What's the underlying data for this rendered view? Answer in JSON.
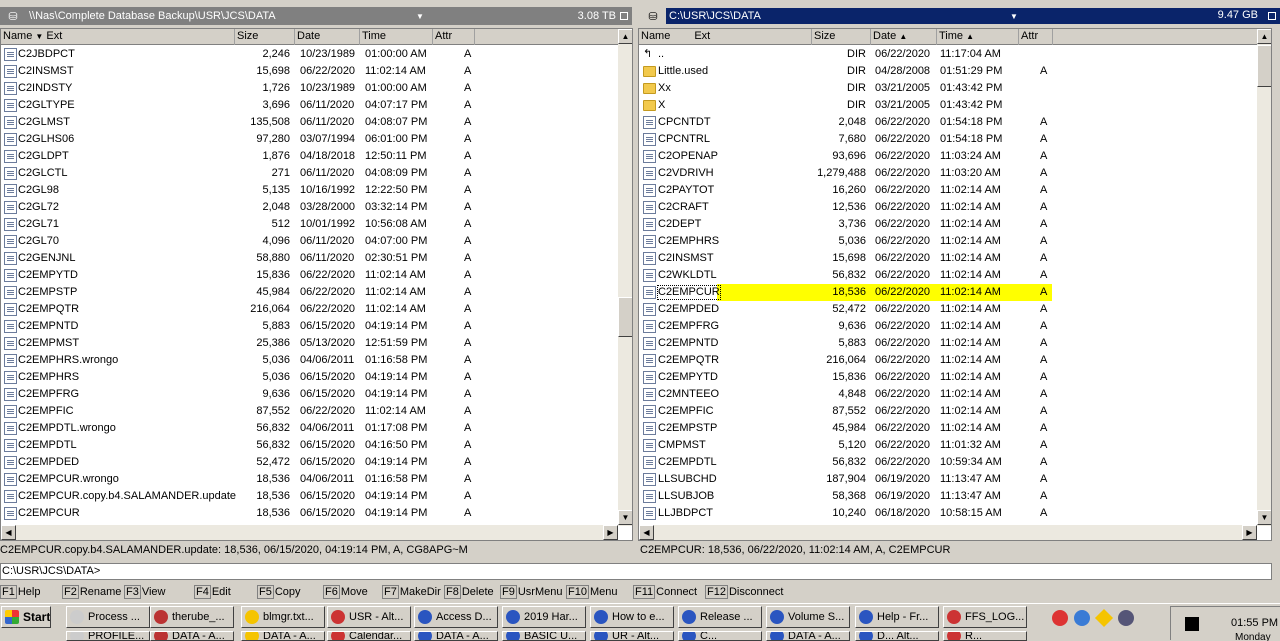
{
  "left_panel": {
    "path": "\\\\Nas\\Complete Database Backup\\USR\\JCS\\DATA",
    "free_space": "3.08 TB",
    "columns": {
      "name": "Name",
      "ext": "Ext",
      "size": "Size",
      "date": "Date",
      "time": "Time",
      "attr": "Attr"
    },
    "rows": [
      {
        "name": "C2JBDPCT",
        "size": "2,246",
        "date": "10/23/1989",
        "time": "01:00:00 AM",
        "attr": "A"
      },
      {
        "name": "C2INSMST",
        "size": "15,698",
        "date": "06/22/2020",
        "time": "11:02:14 AM",
        "attr": "A"
      },
      {
        "name": "C2INDSTY",
        "size": "1,726",
        "date": "10/23/1989",
        "time": "01:00:00 AM",
        "attr": "A"
      },
      {
        "name": "C2GLTYPE",
        "size": "3,696",
        "date": "06/11/2020",
        "time": "04:07:17 PM",
        "attr": "A"
      },
      {
        "name": "C2GLMST",
        "size": "135,508",
        "date": "06/11/2020",
        "time": "04:08:07 PM",
        "attr": "A"
      },
      {
        "name": "C2GLHS06",
        "size": "97,280",
        "date": "03/07/1994",
        "time": "06:01:00 PM",
        "attr": "A"
      },
      {
        "name": "C2GLDPT",
        "size": "1,876",
        "date": "04/18/2018",
        "time": "12:50:11 PM",
        "attr": "A"
      },
      {
        "name": "C2GLCTL",
        "size": "271",
        "date": "06/11/2020",
        "time": "04:08:09 PM",
        "attr": "A"
      },
      {
        "name": "C2GL98",
        "size": "5,135",
        "date": "10/16/1992",
        "time": "12:22:50 PM",
        "attr": "A"
      },
      {
        "name": "C2GL72",
        "size": "2,048",
        "date": "03/28/2000",
        "time": "03:32:14 PM",
        "attr": "A"
      },
      {
        "name": "C2GL71",
        "size": "512",
        "date": "10/01/1992",
        "time": "10:56:08 AM",
        "attr": "A"
      },
      {
        "name": "C2GL70",
        "size": "4,096",
        "date": "06/11/2020",
        "time": "04:07:00 PM",
        "attr": "A"
      },
      {
        "name": "C2GENJNL",
        "size": "58,880",
        "date": "06/11/2020",
        "time": "02:30:51 PM",
        "attr": "A"
      },
      {
        "name": "C2EMPYTD",
        "size": "15,836",
        "date": "06/22/2020",
        "time": "11:02:14 AM",
        "attr": "A"
      },
      {
        "name": "C2EMPSTP",
        "size": "45,984",
        "date": "06/22/2020",
        "time": "11:02:14 AM",
        "attr": "A"
      },
      {
        "name": "C2EMPQTR",
        "size": "216,064",
        "date": "06/22/2020",
        "time": "11:02:14 AM",
        "attr": "A"
      },
      {
        "name": "C2EMPNTD",
        "size": "5,883",
        "date": "06/15/2020",
        "time": "04:19:14 PM",
        "attr": "A"
      },
      {
        "name": "C2EMPMST",
        "size": "25,386",
        "date": "05/13/2020",
        "time": "12:51:59 PM",
        "attr": "A"
      },
      {
        "name": "C2EMPHRS.wrongo",
        "size": "5,036",
        "date": "04/06/2011",
        "time": "01:16:58 PM",
        "attr": "A"
      },
      {
        "name": "C2EMPHRS",
        "size": "5,036",
        "date": "06/15/2020",
        "time": "04:19:14 PM",
        "attr": "A"
      },
      {
        "name": "C2EMPFRG",
        "size": "9,636",
        "date": "06/15/2020",
        "time": "04:19:14 PM",
        "attr": "A"
      },
      {
        "name": "C2EMPFIC",
        "size": "87,552",
        "date": "06/22/2020",
        "time": "11:02:14 AM",
        "attr": "A"
      },
      {
        "name": "C2EMPDTL.wrongo",
        "size": "56,832",
        "date": "04/06/2011",
        "time": "01:17:08 PM",
        "attr": "A"
      },
      {
        "name": "C2EMPDTL",
        "size": "56,832",
        "date": "06/15/2020",
        "time": "04:16:50 PM",
        "attr": "A"
      },
      {
        "name": "C2EMPDED",
        "size": "52,472",
        "date": "06/15/2020",
        "time": "04:19:14 PM",
        "attr": "A"
      },
      {
        "name": "C2EMPCUR.wrongo",
        "size": "18,536",
        "date": "04/06/2011",
        "time": "01:16:58 PM",
        "attr": "A"
      },
      {
        "name": "C2EMPCUR.copy.b4.SALAMANDER.update",
        "size": "18,536",
        "date": "06/15/2020",
        "time": "04:19:14 PM",
        "attr": "A"
      },
      {
        "name": "C2EMPCUR",
        "size": "18,536",
        "date": "06/15/2020",
        "time": "04:19:14 PM",
        "attr": "A"
      }
    ],
    "status": "C2EMPCUR.copy.b4.SALAMANDER.update: 18,536, 06/15/2020, 04:19:14 PM, A, CG8APG~M"
  },
  "right_panel": {
    "path": "C:\\USR\\JCS\\DATA",
    "free_space": "9.47 GB",
    "columns": {
      "name": "Name",
      "ext": "Ext",
      "size": "Size",
      "date": "Date",
      "time": "Time",
      "attr": "Attr"
    },
    "rows": [
      {
        "name": "..",
        "icon": "up",
        "size": "DIR",
        "date": "06/22/2020",
        "time": "11:17:04 AM",
        "attr": ""
      },
      {
        "name": "Little.used",
        "icon": "folder",
        "size": "DIR",
        "date": "04/28/2008",
        "time": "01:51:29 PM",
        "attr": "A"
      },
      {
        "name": "Xx",
        "icon": "folder",
        "size": "DIR",
        "date": "03/21/2005",
        "time": "01:43:42 PM",
        "attr": ""
      },
      {
        "name": "X",
        "icon": "folder",
        "size": "DIR",
        "date": "03/21/2005",
        "time": "01:43:42 PM",
        "attr": ""
      },
      {
        "name": "CPCNTDT",
        "size": "2,048",
        "date": "06/22/2020",
        "time": "01:54:18 PM",
        "attr": "A"
      },
      {
        "name": "CPCNTRL",
        "size": "7,680",
        "date": "06/22/2020",
        "time": "01:54:18 PM",
        "attr": "A"
      },
      {
        "name": "C2OPENAP",
        "size": "93,696",
        "date": "06/22/2020",
        "time": "11:03:24 AM",
        "attr": "A"
      },
      {
        "name": "C2VDRIVH",
        "size": "1,279,488",
        "date": "06/22/2020",
        "time": "11:03:20 AM",
        "attr": "A"
      },
      {
        "name": "C2PAYTOT",
        "size": "16,260",
        "date": "06/22/2020",
        "time": "11:02:14 AM",
        "attr": "A"
      },
      {
        "name": "C2CRAFT",
        "size": "12,536",
        "date": "06/22/2020",
        "time": "11:02:14 AM",
        "attr": "A"
      },
      {
        "name": "C2DEPT",
        "size": "3,736",
        "date": "06/22/2020",
        "time": "11:02:14 AM",
        "attr": "A"
      },
      {
        "name": "C2EMPHRS",
        "size": "5,036",
        "date": "06/22/2020",
        "time": "11:02:14 AM",
        "attr": "A"
      },
      {
        "name": "C2INSMST",
        "size": "15,698",
        "date": "06/22/2020",
        "time": "11:02:14 AM",
        "attr": "A"
      },
      {
        "name": "C2WKLDTL",
        "size": "56,832",
        "date": "06/22/2020",
        "time": "11:02:14 AM",
        "attr": "A"
      },
      {
        "name": "C2EMPCUR",
        "size": "18,536",
        "date": "06/22/2020",
        "time": "11:02:14 AM",
        "attr": "A",
        "selected": true
      },
      {
        "name": "C2EMPDED",
        "size": "52,472",
        "date": "06/22/2020",
        "time": "11:02:14 AM",
        "attr": "A"
      },
      {
        "name": "C2EMPFRG",
        "size": "9,636",
        "date": "06/22/2020",
        "time": "11:02:14 AM",
        "attr": "A"
      },
      {
        "name": "C2EMPNTD",
        "size": "5,883",
        "date": "06/22/2020",
        "time": "11:02:14 AM",
        "attr": "A"
      },
      {
        "name": "C2EMPQTR",
        "size": "216,064",
        "date": "06/22/2020",
        "time": "11:02:14 AM",
        "attr": "A"
      },
      {
        "name": "C2EMPYTD",
        "size": "15,836",
        "date": "06/22/2020",
        "time": "11:02:14 AM",
        "attr": "A"
      },
      {
        "name": "C2MNTEEO",
        "size": "4,848",
        "date": "06/22/2020",
        "time": "11:02:14 AM",
        "attr": "A"
      },
      {
        "name": "C2EMPFIC",
        "size": "87,552",
        "date": "06/22/2020",
        "time": "11:02:14 AM",
        "attr": "A"
      },
      {
        "name": "C2EMPSTP",
        "size": "45,984",
        "date": "06/22/2020",
        "time": "11:02:14 AM",
        "attr": "A"
      },
      {
        "name": "CMPMST",
        "size": "5,120",
        "date": "06/22/2020",
        "time": "11:01:32 AM",
        "attr": "A"
      },
      {
        "name": "C2EMPDTL",
        "size": "56,832",
        "date": "06/22/2020",
        "time": "10:59:34 AM",
        "attr": "A"
      },
      {
        "name": "LLSUBCHD",
        "size": "187,904",
        "date": "06/19/2020",
        "time": "11:13:47 AM",
        "attr": "A"
      },
      {
        "name": "LLSUBJOB",
        "size": "58,368",
        "date": "06/19/2020",
        "time": "11:13:47 AM",
        "attr": "A"
      },
      {
        "name": "LLJBDPCT",
        "size": "10,240",
        "date": "06/18/2020",
        "time": "10:58:15 AM",
        "attr": "A"
      }
    ],
    "status": "C2EMPCUR: 18,536, 06/22/2020, 11:02:14 AM, A, C2EMPCUR"
  },
  "command_line": "C:\\USR\\JCS\\DATA>",
  "function_keys": [
    {
      "key": "F1",
      "label": "Help"
    },
    {
      "key": "F2",
      "label": "Rename"
    },
    {
      "key": "F3",
      "label": "View"
    },
    {
      "key": "F4",
      "label": "Edit"
    },
    {
      "key": "F5",
      "label": "Copy"
    },
    {
      "key": "F6",
      "label": "Move"
    },
    {
      "key": "F7",
      "label": "MakeDir"
    },
    {
      "key": "F8",
      "label": "Delete"
    },
    {
      "key": "F9",
      "label": "UsrMenu"
    },
    {
      "key": "F10",
      "label": "Menu"
    },
    {
      "key": "F11",
      "label": "Connect"
    },
    {
      "key": "F12",
      "label": "Disconnect"
    }
  ],
  "taskbar": {
    "start": "Start",
    "buttons_row1": [
      "Process ...",
      "therube_...",
      "blmgr.txt...",
      "USR - Alt...",
      "Access D...",
      "2019 Har...",
      "How to e...",
      "Release ...",
      "Volume S...",
      "Help - Fr...",
      "FFS_LOG..."
    ],
    "buttons_row2": [
      "PROFILE...",
      "DATA - A...",
      "DATA - A...",
      "Calendar...",
      "DATA - A...",
      "BASIC U...",
      "UR - Alt...",
      "C...",
      "DATA - A...",
      "D... Alt...",
      "R..."
    ],
    "clock": "01:55 PM",
    "clock_day": "Monday"
  },
  "colors": {
    "selection": "#ffff00",
    "active_path": "#0a246a",
    "inactive_path": "#808080"
  }
}
